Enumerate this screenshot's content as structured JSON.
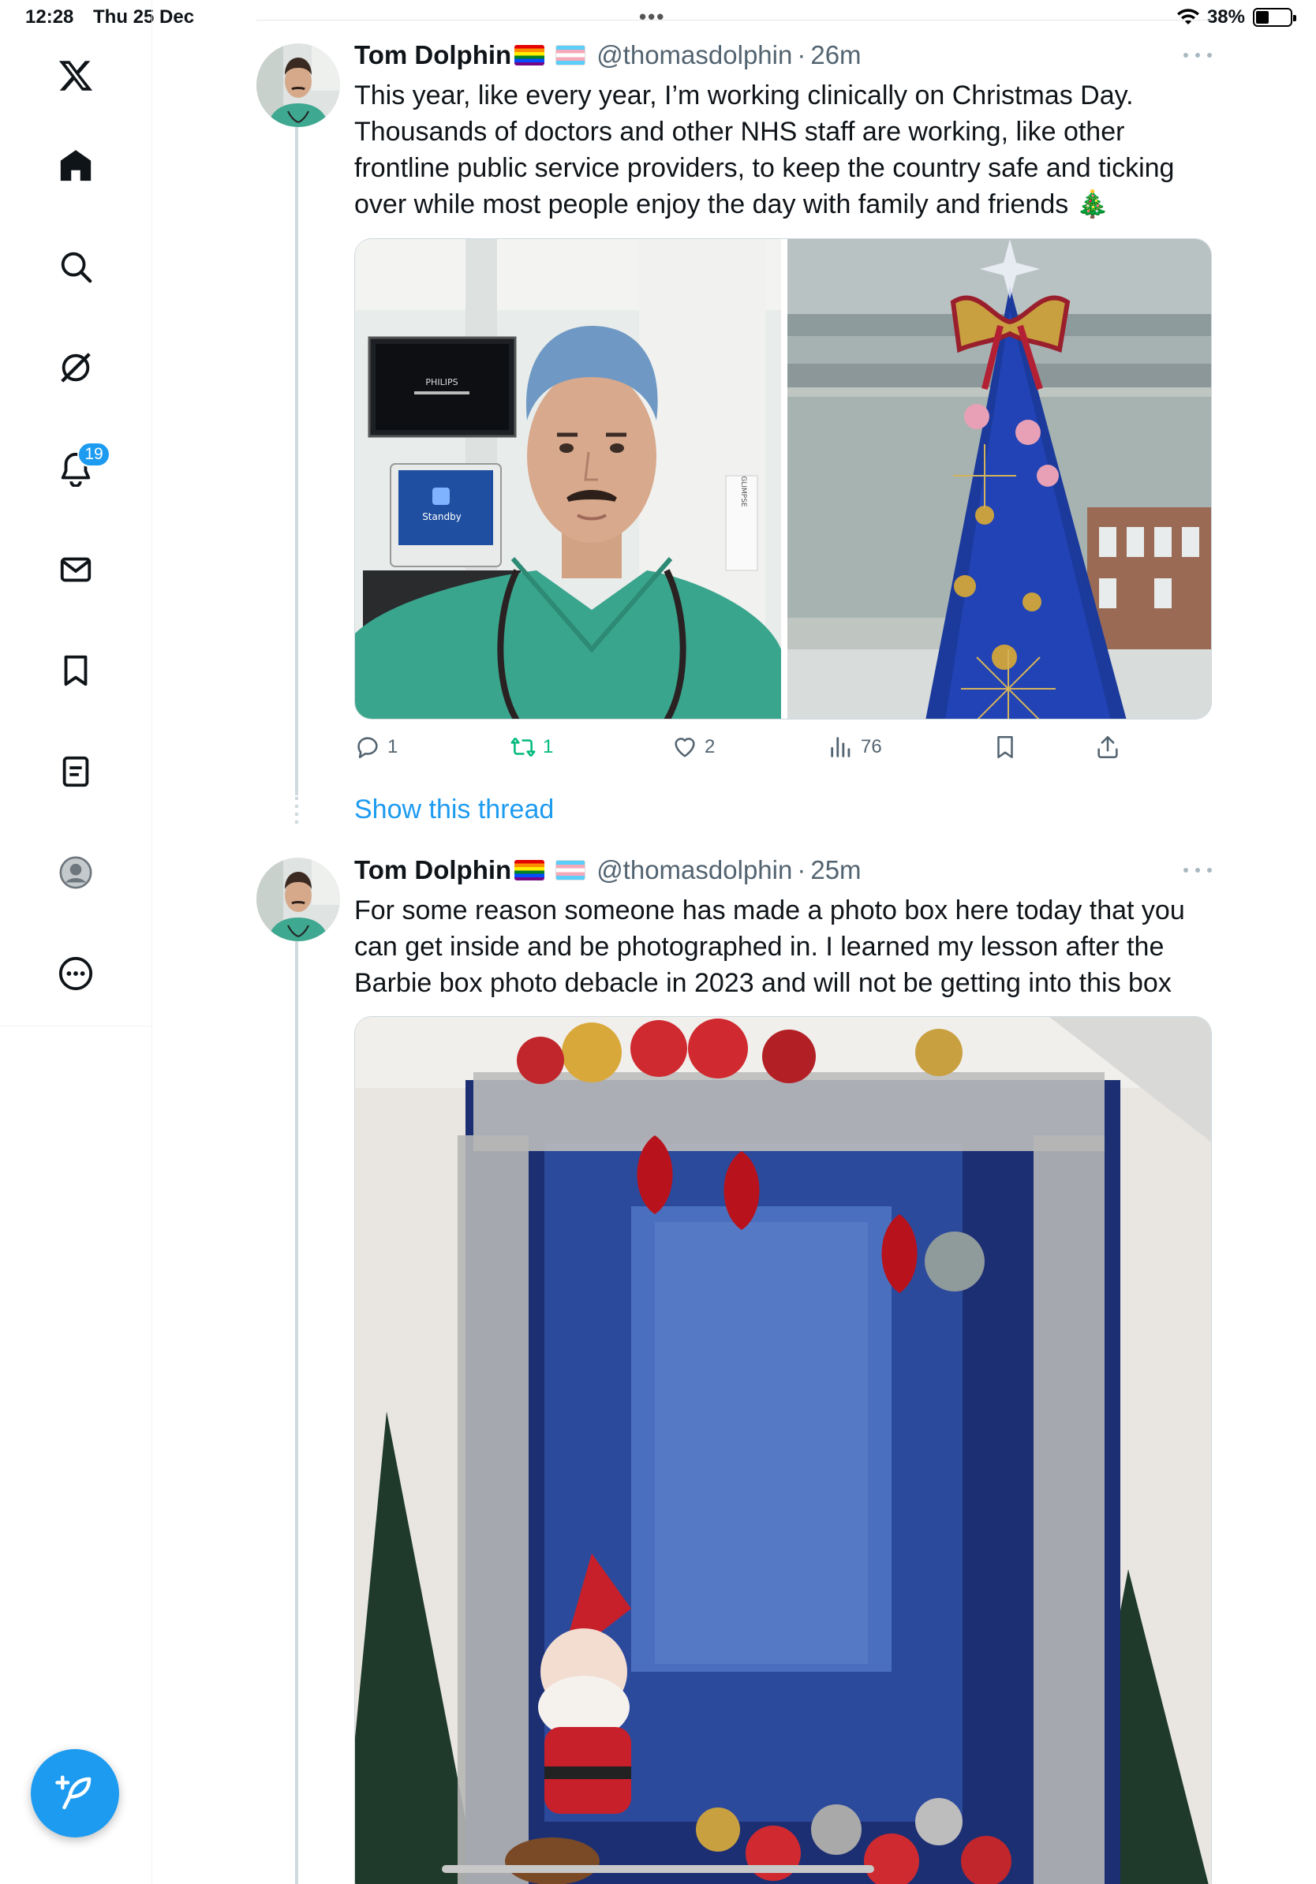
{
  "status_bar": {
    "time": "12:28",
    "date": "Thu 25 Dec",
    "battery_percent": "38%",
    "battery_level": 0.38
  },
  "nav": {
    "items": [
      "x-logo",
      "home-icon",
      "search-icon",
      "grok-icon",
      "notifications-icon",
      "messages-icon",
      "bookmarks-icon",
      "lists-icon",
      "profile-icon",
      "more-icon"
    ],
    "notifications_badge": "19"
  },
  "colors": {
    "accent": "#1d9bf0",
    "retweet_active": "#00ba7c",
    "secondary_text": "#536471"
  },
  "tweets": [
    {
      "author_name": "Tom Dolphin",
      "handle": "@thomasdolphin",
      "separator": "·",
      "time": "26m",
      "text": "This year, like every year, I’m working clinically on Christmas Day. Thousands of doctors and other NHS staff are working, like other frontline public service providers, to keep the country safe and ticking over while most people enjoy the day with family and friends 🎄",
      "media": [
        {
          "monitor_brand": "PHILIPS",
          "screen_text": "Standby",
          "sign_text": "GLIMPSE"
        },
        {
          "description_icon": "christmas-tree-photo"
        }
      ],
      "replies": "1",
      "retweets": "1",
      "likes": "2",
      "views": "76"
    },
    {
      "author_name": "Tom Dolphin",
      "handle": "@thomasdolphin",
      "separator": "·",
      "time": "25m",
      "text": "For some reason someone has made a photo box here today that you can get inside and be photographed in. I learned my lesson after the Barbie box photo debacle in 2023 and will not be getting into this box",
      "media": [
        {
          "description_icon": "photo-box-photo"
        }
      ]
    }
  ],
  "show_thread_label": "Show this thread"
}
